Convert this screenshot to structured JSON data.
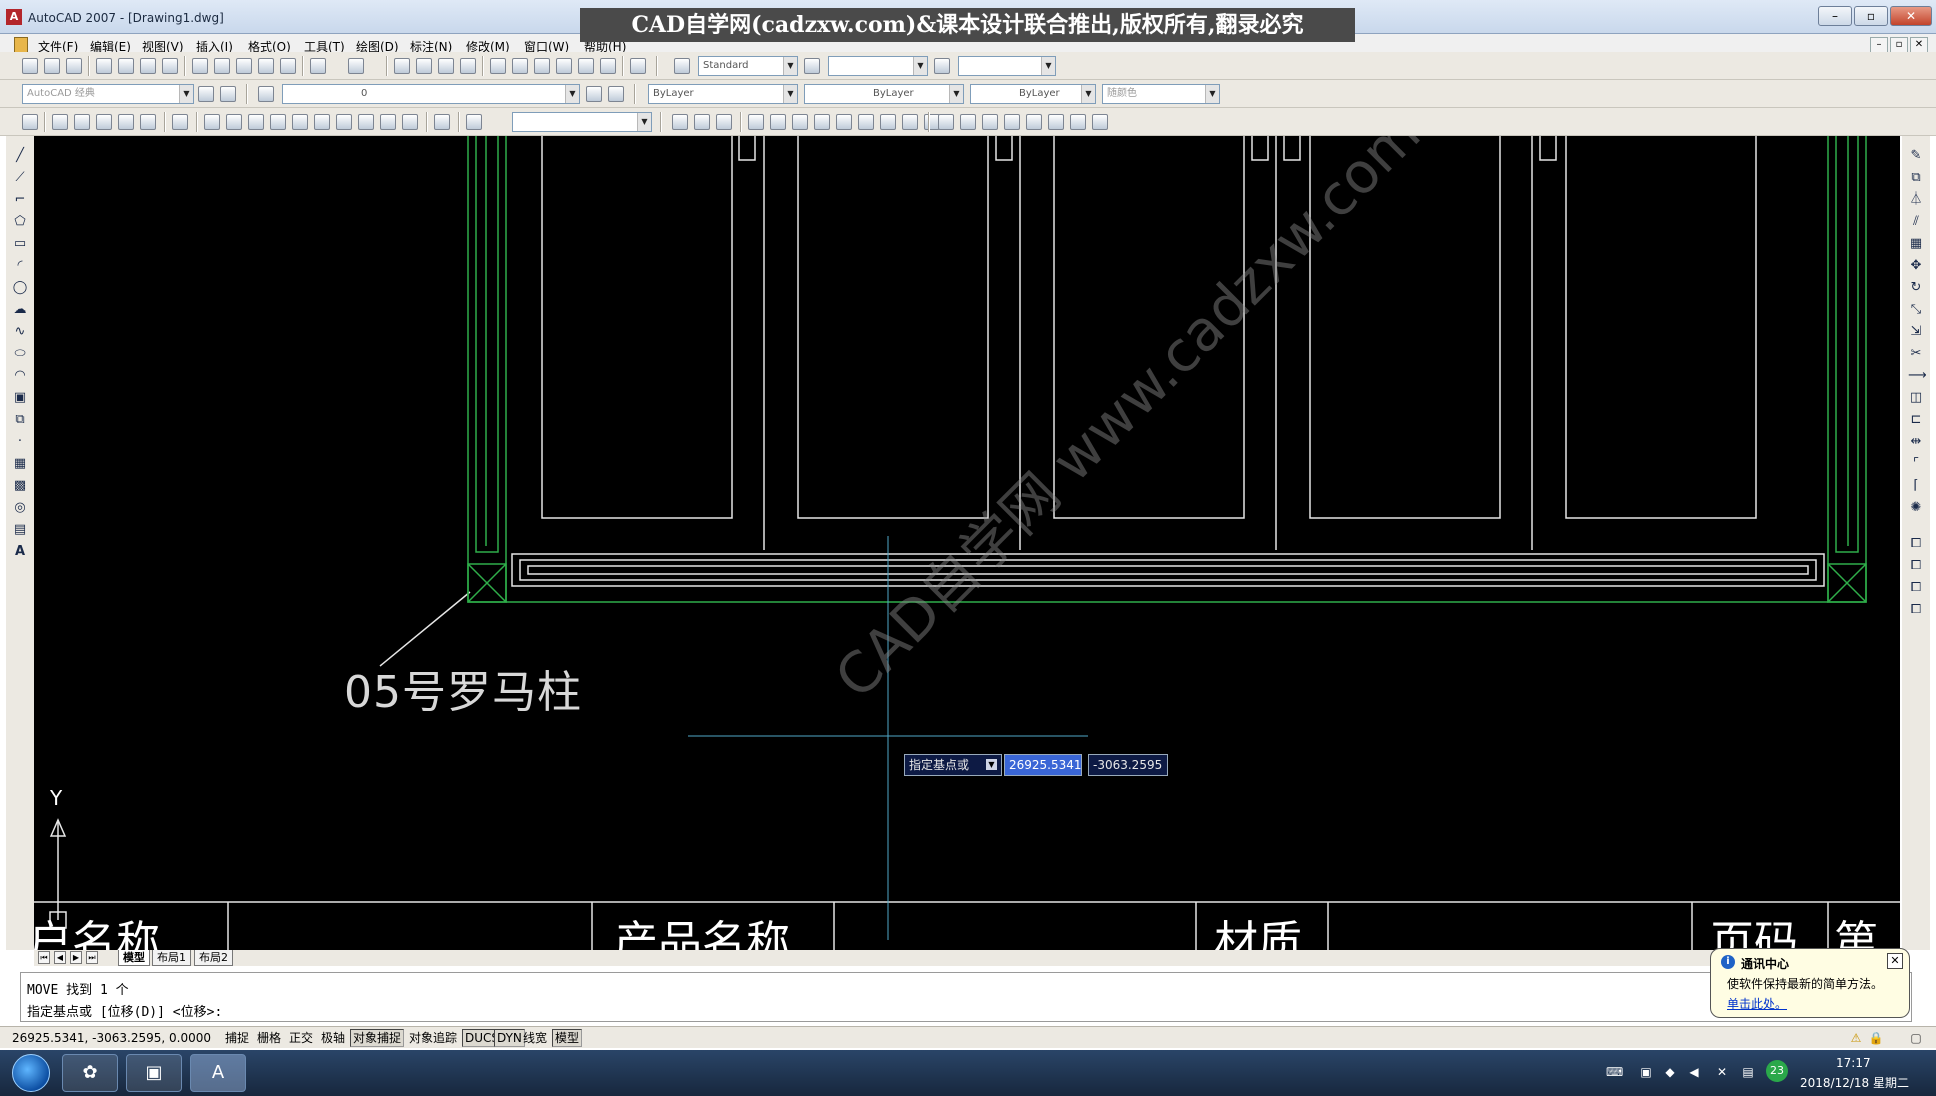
{
  "window": {
    "title": "AutoCAD 2007 - [Drawing1.dwg]",
    "watermark_banner": "CAD自学网(cadzxw.com)&课本设计联合推出,版权所有,翻录必究",
    "buttons": {
      "minimize": "–",
      "restore": "▫",
      "close": "✕"
    }
  },
  "menubar": {
    "items": [
      "文件(F)",
      "编辑(E)",
      "视图(V)",
      "插入(I)",
      "格式(O)",
      "工具(T)",
      "绘图(D)",
      "标注(N)",
      "修改(M)",
      "窗口(W)",
      "帮助(H)"
    ]
  },
  "toolbars": {
    "text_style": "Standard",
    "dim_style": "",
    "table_style": "",
    "workspace": "AutoCAD 经典",
    "layer": "0",
    "color": "ByLayer",
    "linetype": "ByLayer",
    "lineweight": "ByLayer",
    "plot_style": "随颜色",
    "view_combo": ""
  },
  "drawing": {
    "label": "05号罗马柱",
    "axis_y": "Y",
    "table_headers": [
      "户名称",
      "产品名称",
      "材质",
      "页码",
      "第"
    ],
    "watermark": "CAD自学网 www.cadzxw.com"
  },
  "dynamic_input": {
    "prompt": "指定基点或",
    "x_value": "26925.5341",
    "y_value": "-3063.2595"
  },
  "layout_tabs": [
    "模型",
    "布局1",
    "布局2"
  ],
  "command_line": {
    "history": "MOVE 找到 1 个",
    "prompt": "指定基点或 [位移(D)] <位移>:"
  },
  "statusbar": {
    "coords": "26925.5341, -3063.2595, 0.0000",
    "toggles": [
      "捕捉",
      "栅格",
      "正交",
      "极轴",
      "对象捕捉",
      "对象追踪",
      "DUCS",
      "DYN",
      "线宽",
      "模型"
    ]
  },
  "comm_center": {
    "title": "通讯中心",
    "body": "使软件保持最新的简单方法。",
    "link": "单击此处。",
    "close": "✕"
  },
  "taskbar": {
    "clock_time": "17:17",
    "clock_date": "2018/12/18 星期二",
    "badge": "23"
  },
  "colors": {
    "canvas": "#000000",
    "frame_green": "#2fae4a",
    "drawing_white": "#e6e6e6",
    "crosshair": "#4fa7c8"
  }
}
